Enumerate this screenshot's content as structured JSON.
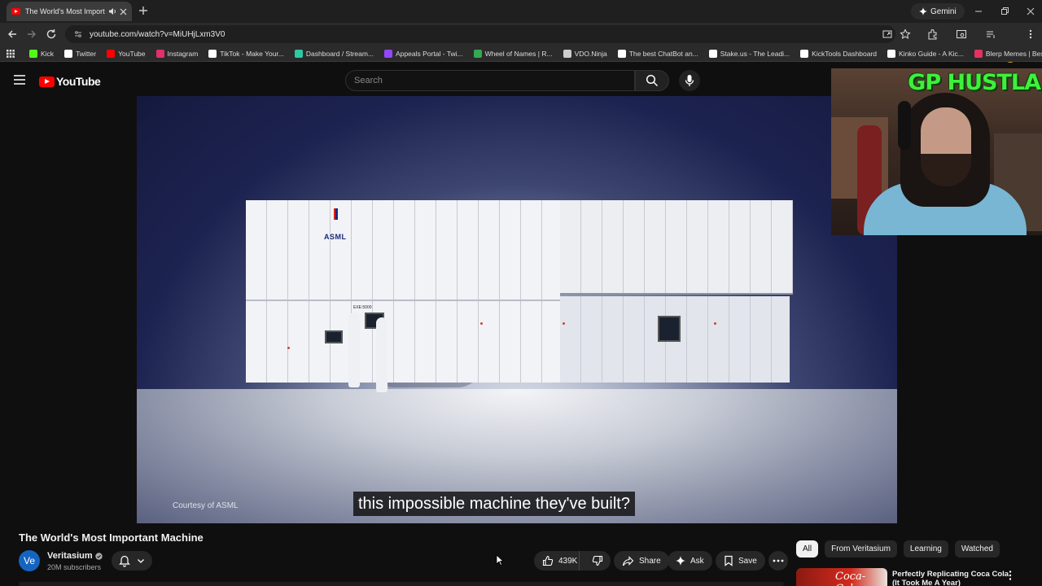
{
  "browser": {
    "tab_title": "The World's Most Importan",
    "url": "youtube.com/watch?v=MiUHjLxm3V0",
    "gemini_label": "Gemini",
    "bookmarks": [
      {
        "label": "Kick",
        "color": "#53fc18"
      },
      {
        "label": "Twitter",
        "color": "#ffffff"
      },
      {
        "label": "YouTube",
        "color": "#ff0000"
      },
      {
        "label": "Instagram",
        "color": "#e1306c"
      },
      {
        "label": "TikTok - Make Your...",
        "color": "#ffffff"
      },
      {
        "label": "Dashboard / Stream...",
        "color": "#2cc9a5"
      },
      {
        "label": "Appeals Portal - Twi...",
        "color": "#9146ff"
      },
      {
        "label": "Wheel of Names | R...",
        "color": "#34a853"
      },
      {
        "label": "VDO.Ninja",
        "color": "#cccccc"
      },
      {
        "label": "The best ChatBot an...",
        "color": "#ffffff"
      },
      {
        "label": "Stake.us - The Leadi...",
        "color": "#ffffff"
      },
      {
        "label": "KickTools Dashboard",
        "color": "#ffffff"
      },
      {
        "label": "Kinko Guide - A Kic...",
        "color": "#ffffff"
      },
      {
        "label": "Blerp Memes | Best...",
        "color": "#e3325f"
      }
    ]
  },
  "youtube": {
    "logo_text": "YouTube",
    "search_placeholder": "Search"
  },
  "video": {
    "courtesy": "Courtesy of ASML",
    "caption": "this impossible machine they've built?",
    "machine_brand": "ASML",
    "machine_model": "EXE:5000"
  },
  "webcam": {
    "overlay_text": "GP HUSTLA"
  },
  "watch": {
    "title": "The World's Most Important Machine",
    "channel_initials": "Ve",
    "channel_name": "Veritasium",
    "subscribers": "20M subscribers",
    "likes": "439K",
    "share_label": "Share",
    "ask_label": "Ask",
    "save_label": "Save"
  },
  "sidebar": {
    "chips": [
      {
        "label": "All",
        "active": true
      },
      {
        "label": "From Veritasium",
        "active": false
      },
      {
        "label": "Learning",
        "active": false
      },
      {
        "label": "Watched",
        "active": false
      }
    ],
    "recommendation": {
      "title": "Perfectly Replicating Coca Cola (It Took Me A Year)",
      "thumb_text": "Coca-Cola"
    }
  }
}
